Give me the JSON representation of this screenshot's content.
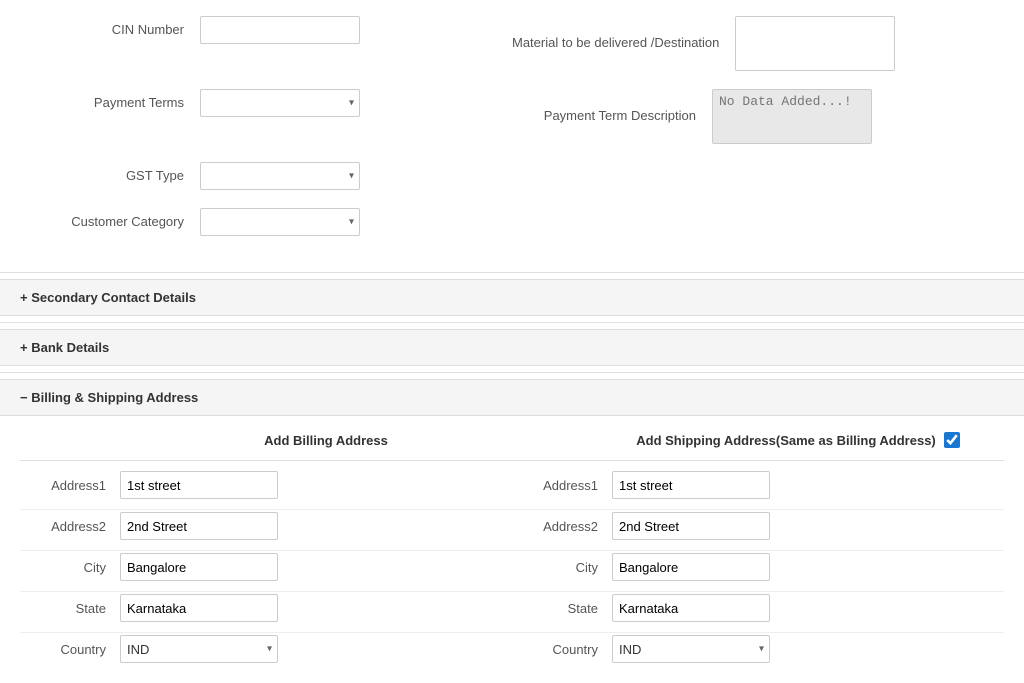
{
  "form": {
    "cin_number_label": "CIN Number",
    "material_destination_label": "Material to be delivered /Destination",
    "payment_terms_label": "Payment Terms",
    "payment_term_desc_label": "Payment Term Description",
    "payment_term_desc_placeholder": "No Data Added...!",
    "gst_type_label": "GST Type",
    "customer_category_label": "Customer Category"
  },
  "sections": {
    "secondary_contact": "+ Secondary Contact Details",
    "bank_details": "+ Bank Details",
    "billing_shipping": "− Billing & Shipping Address"
  },
  "address": {
    "billing_header": "Add Billing Address",
    "shipping_header": "Add Shipping Address(Same as Billing Address)",
    "same_as_billing_checked": true,
    "fields": [
      {
        "label": "Address1",
        "billing_value": "1st street",
        "shipping_value": "1st street"
      },
      {
        "label": "Address2",
        "billing_value": "2nd Street",
        "shipping_value": "2nd Street"
      },
      {
        "label": "City",
        "billing_value": "Bangalore",
        "shipping_value": "Bangalore"
      },
      {
        "label": "State",
        "billing_value": "Karnataka",
        "shipping_value": "Karnataka"
      },
      {
        "label": "Country",
        "billing_value": "IND",
        "shipping_value": "IND"
      }
    ]
  },
  "icons": {
    "dropdown_arrow": "▾",
    "plus": "+",
    "minus": "−"
  }
}
